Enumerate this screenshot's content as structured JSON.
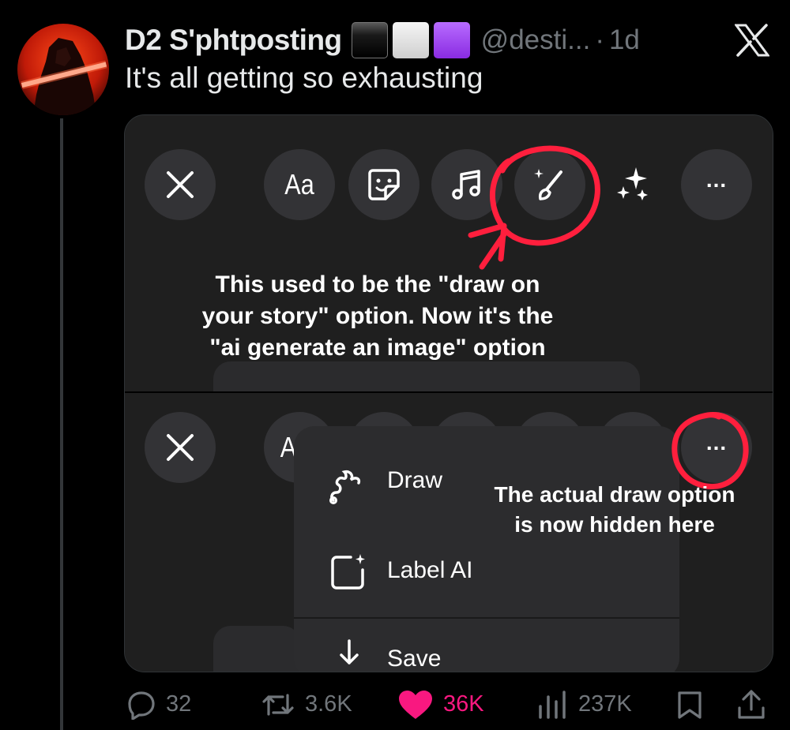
{
  "tweet": {
    "display_name": "D2 S'phtposting",
    "name_emojis": [
      "black-square",
      "white-square",
      "purple-square"
    ],
    "handle": "@desti...",
    "separator": "·",
    "time": "1d",
    "text": "It's all getting so exhausting"
  },
  "media": {
    "top_panel": {
      "toolbar": [
        {
          "icon": "close-icon"
        },
        {
          "icon": "text-icon",
          "label": "Aa"
        },
        {
          "icon": "sticker-icon"
        },
        {
          "icon": "music-icon"
        },
        {
          "icon": "paintbrush-sparkle-icon"
        },
        {
          "icon": "sparkles-icon"
        },
        {
          "icon": "more-icon",
          "label": "..."
        }
      ],
      "annotation_lines": [
        "This used to be the \"draw on",
        "your story\" option. Now it's the",
        "\"ai generate an image\" option"
      ],
      "highlight_color": "#ff1f3d"
    },
    "bottom_panel": {
      "partial_label": "A",
      "more_label": "...",
      "menu": [
        {
          "icon": "draw-squiggle-icon",
          "label": "Draw"
        },
        {
          "icon": "label-ai-icon",
          "label": "Label AI"
        },
        {
          "icon": "download-arrow-icon",
          "label": "Save"
        }
      ],
      "annotation_lines": [
        "The actual draw option",
        "is now hidden here"
      ]
    }
  },
  "actions": {
    "replies": "32",
    "reposts": "3.6K",
    "likes": "36K",
    "views": "237K",
    "like_color": "#f91880"
  },
  "colors": {
    "background": "#000000",
    "text": "#e7e9ea",
    "muted": "#71767b",
    "thread_line": "#333639"
  }
}
